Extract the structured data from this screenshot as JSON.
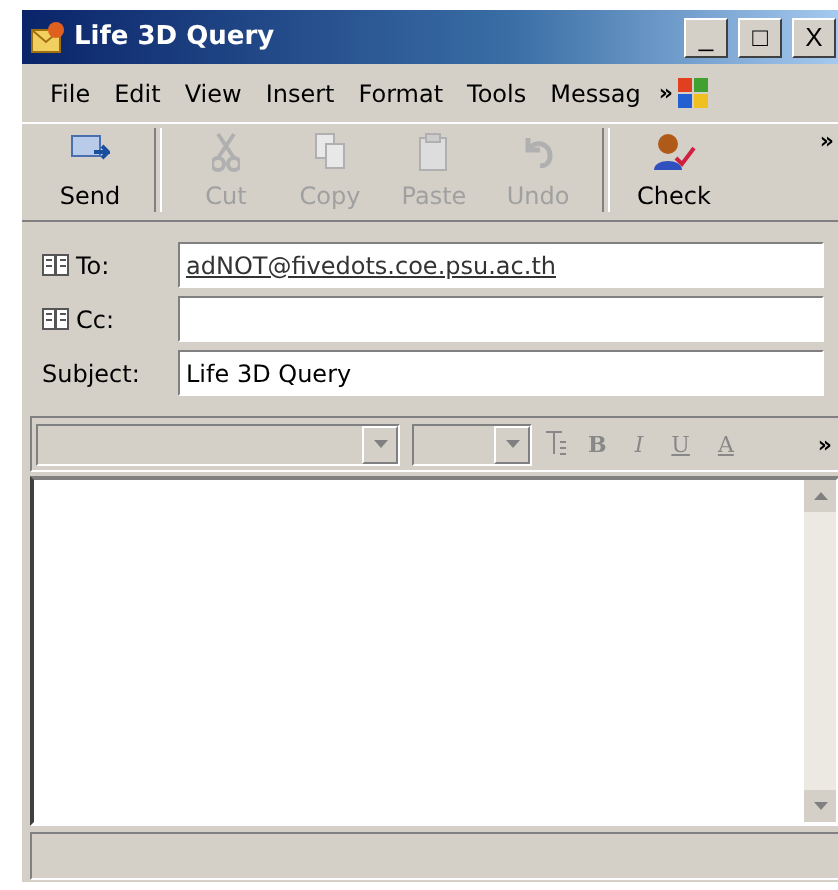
{
  "window": {
    "title": "Life 3D Query",
    "controls": [
      "_",
      "□",
      "X"
    ]
  },
  "menu": {
    "items": [
      "File",
      "Edit",
      "View",
      "Insert",
      "Format",
      "Tools",
      "Messag"
    ],
    "more": "»"
  },
  "toolbar": {
    "buttons": [
      {
        "label": "Send",
        "kind": "send",
        "disabled": false
      },
      {
        "label": "Cut",
        "kind": "cut",
        "disabled": true
      },
      {
        "label": "Copy",
        "kind": "copy",
        "disabled": true
      },
      {
        "label": "Paste",
        "kind": "paste",
        "disabled": true
      },
      {
        "label": "Undo",
        "kind": "undo",
        "disabled": true
      },
      {
        "label": "Check",
        "kind": "check",
        "disabled": false
      }
    ],
    "more": "»"
  },
  "fields": [
    {
      "label": "To:",
      "kind": "address",
      "value": "adNOT@fivedots.coe.psu.ac.th"
    },
    {
      "label": "Cc:",
      "kind": "address"
    },
    {
      "label": "Subject:",
      "kind": "plain",
      "value": "Life 3D Query"
    }
  ],
  "format_bar": {
    "buttons": [
      "B",
      "I",
      "U",
      "A"
    ],
    "more": "»"
  }
}
